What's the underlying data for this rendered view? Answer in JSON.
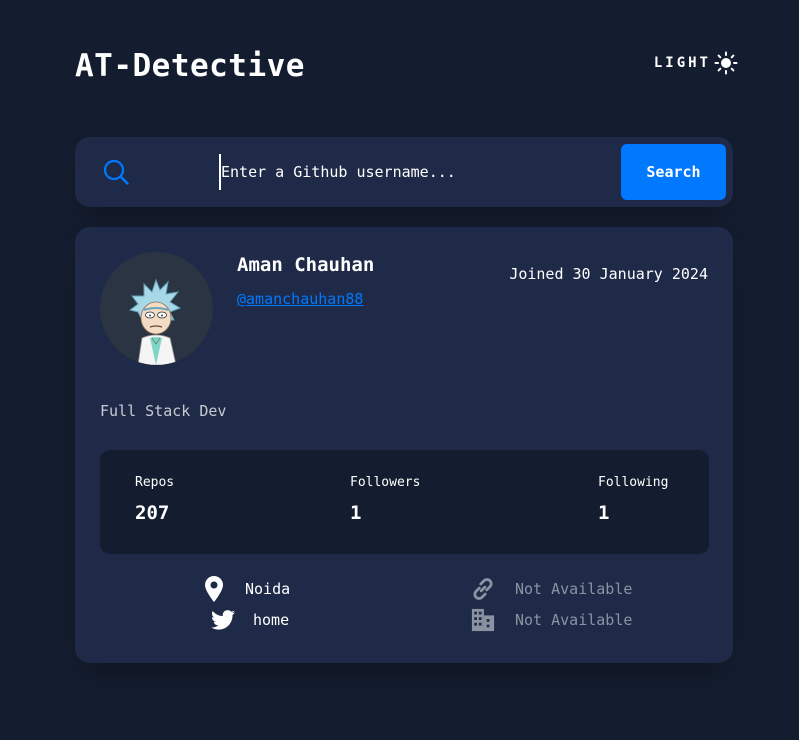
{
  "app": {
    "title": "AT-Detective",
    "theme_toggle_label": "LIGHT",
    "theme_icon": "sun-icon"
  },
  "search": {
    "placeholder": "Enter a Github username...",
    "value": "",
    "button_label": "Search",
    "icon": "search-icon"
  },
  "profile": {
    "name": "Aman Chauhan",
    "login": "@amanchauhan88",
    "joined": "Joined 30 January 2024",
    "bio": "Full Stack Dev",
    "avatar_icon": "rick-avatar"
  },
  "stats": {
    "repos_label": "Repos",
    "repos_value": "207",
    "followers_label": "Followers",
    "followers_value": "1",
    "following_label": "Following",
    "following_value": "1"
  },
  "links": {
    "location": "Noida",
    "twitter": "home",
    "blog": "Not Available",
    "company": "Not Available"
  },
  "colors": {
    "background": "#141d2f",
    "card": "#1e2a47",
    "accent": "#0079ff",
    "muted": "#8b93a3",
    "text": "#ffffff"
  }
}
